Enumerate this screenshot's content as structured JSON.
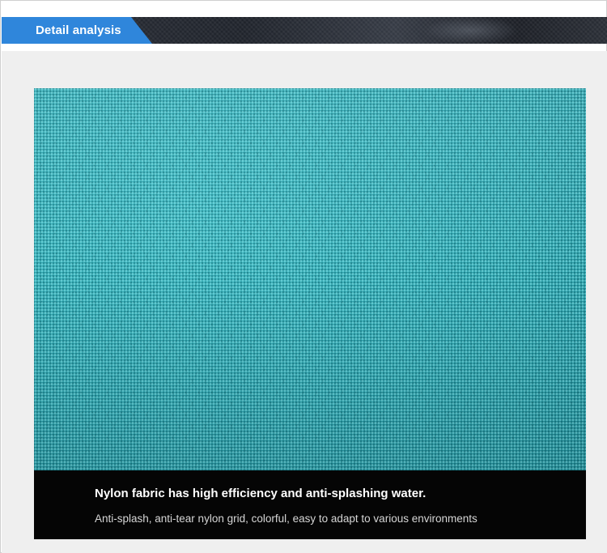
{
  "header": {
    "tab_label": "Detail analysis",
    "accent_color": "#2f86db"
  },
  "main": {
    "image": {
      "semantic": "teal-nylon-fabric-closeup",
      "color": "#2aa3ad"
    },
    "caption": {
      "title": "Nylon fabric has high efficiency and anti-splashing water.",
      "subtitle": "Anti-splash, anti-tear nylon grid, colorful, easy to adapt to various environments"
    }
  }
}
